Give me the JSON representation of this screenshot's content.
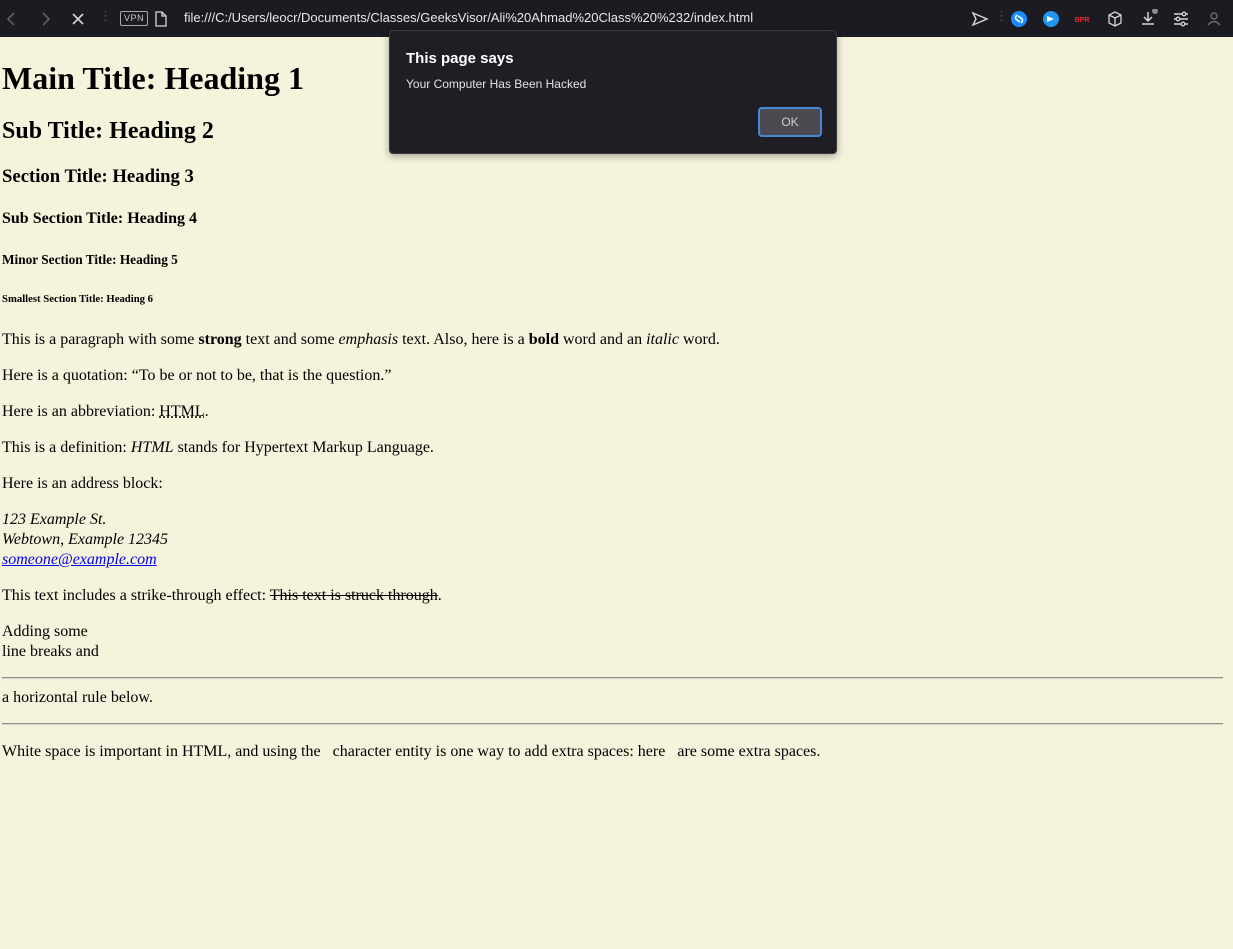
{
  "browser": {
    "vpn_label": "VPN",
    "url": "file:///C:/Users/leocr/Documents/Classes/GeeksVisor/Ali%20Ahmad%20Class%20%232/index.html",
    "extension_badge_text": "BPR"
  },
  "page": {
    "h1": "Main Title: Heading 1",
    "h2": "Sub Title: Heading 2",
    "h3": "Section Title: Heading 3",
    "h4": "Sub Section Title: Heading 4",
    "h5": "Minor Section Title: Heading 5",
    "h6": "Smallest Section Title: Heading 6",
    "intro": {
      "t1": "This is a paragraph with some ",
      "strong": "strong",
      "t2": " text and some ",
      "em": "emphasis",
      "t3": " text. Also, here is a ",
      "bold": "bold",
      "t4": " word and an ",
      "italic": "italic",
      "t5": " word."
    },
    "quote": {
      "prefix": "Here is a quotation: ",
      "text": "“To be or not to be, that is the question.”"
    },
    "abbr": {
      "prefix": "Here is an abbreviation: ",
      "term": "HTML",
      "suffix": "."
    },
    "definition": {
      "prefix": "This is a definition: ",
      "term": "HTML",
      "suffix": " stands for Hypertext Markup Language."
    },
    "address_label": "Here is an address block:",
    "address": {
      "line1": "123 Example St.",
      "line2": "Webtown, Example 12345",
      "email": "someone@example.com"
    },
    "strike": {
      "prefix": "This text includes a strike-through effect: ",
      "struck": "This text is struck through",
      "suffix": "."
    },
    "line_breaks": {
      "line1": "Adding some",
      "line2": "line breaks and"
    },
    "rule_text": "a horizontal rule below.",
    "whitespace_text": "White space is important in HTML, and using the   character entity is one way to add extra spaces: here   are some extra spaces."
  },
  "dialog": {
    "title": "This page says",
    "message": "Your Computer Has Been Hacked",
    "ok_label": "OK"
  }
}
